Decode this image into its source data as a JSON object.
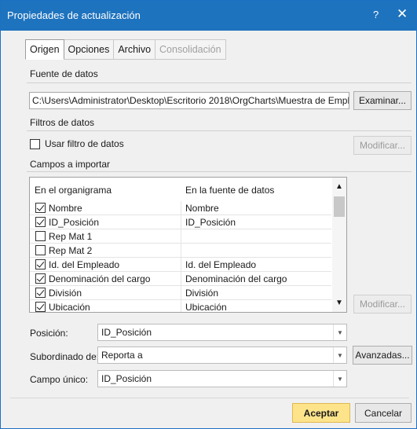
{
  "window": {
    "title": "Propiedades de actualización",
    "help": "?",
    "close": "✕"
  },
  "tabs": [
    {
      "label": "Origen",
      "state": "active"
    },
    {
      "label": "Opciones",
      "state": "normal"
    },
    {
      "label": "Archivo",
      "state": "normal"
    },
    {
      "label": "Consolidación",
      "state": "disabled"
    }
  ],
  "source": {
    "heading": "Fuente de datos",
    "path": "C:\\Users\\Administrator\\Desktop\\Escritorio 2018\\OrgCharts\\Muestra de Empleados.xlsx",
    "browse_label": "Examinar..."
  },
  "filters": {
    "heading": "Filtros de datos",
    "use_filter_label": "Usar filtro de datos",
    "use_filter_checked": false,
    "modify_label": "Modificar..."
  },
  "fields": {
    "heading": "Campos a importar",
    "col1_header": "En el organigrama",
    "col2_header": "En la fuente de datos",
    "rows": [
      {
        "name": "Nombre",
        "source": "Nombre",
        "checked": true
      },
      {
        "name": "ID_Posición",
        "source": "ID_Posición",
        "checked": true
      },
      {
        "name": "Rep Mat 1",
        "source": "",
        "checked": false
      },
      {
        "name": "Rep Mat 2",
        "source": "",
        "checked": false
      },
      {
        "name": "Id. del Empleado",
        "source": "Id. del Empleado",
        "checked": true
      },
      {
        "name": "Denominación del cargo",
        "source": "Denominación del cargo",
        "checked": true
      },
      {
        "name": "División",
        "source": "División",
        "checked": true
      },
      {
        "name": "Ubicación",
        "source": "Ubicación",
        "checked": true
      }
    ],
    "modify_label": "Modificar..."
  },
  "mapping": {
    "position_label": "Posición:",
    "position_value": "ID_Posición",
    "subordinate_label": "Subordinado de:",
    "subordinate_value": "Reporta a",
    "advanced_label": "Avanzadas...",
    "unique_label": "Campo único:",
    "unique_value": "ID_Posición"
  },
  "footer": {
    "accept_label": "Aceptar",
    "cancel_label": "Cancelar"
  }
}
